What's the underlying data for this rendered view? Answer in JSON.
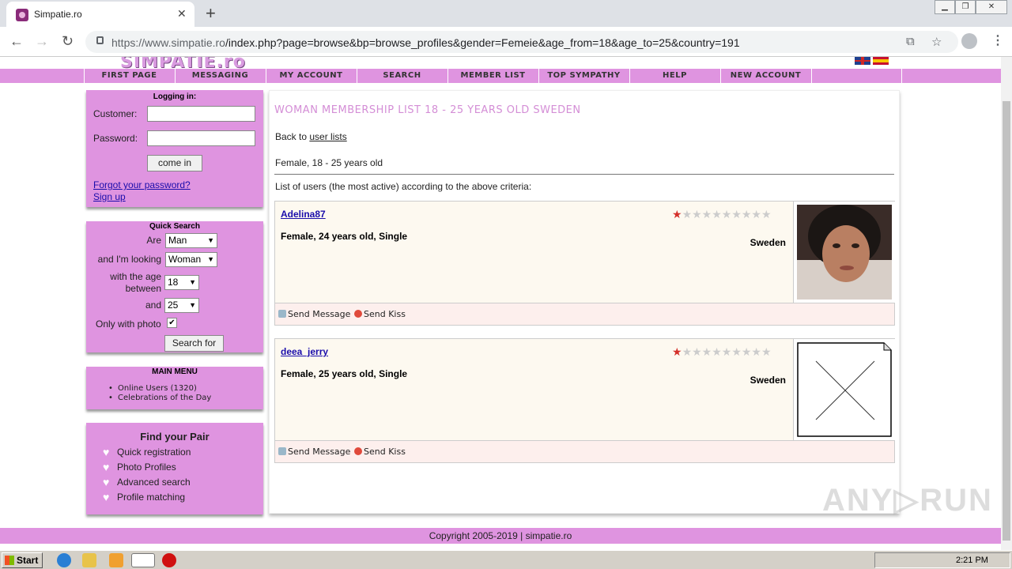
{
  "browser": {
    "tab_title": "Simpatie.ro",
    "tab_close": "✕",
    "new_tab": "+",
    "url_domain": "https://www.simpatie.ro",
    "url_path": "/index.php?page=browse&bp=browse_profiles&gender=Femeie&age_from=18&age_to=25&country=191",
    "back": "←",
    "forward": "→",
    "reload": "↻",
    "translate_icon": "⧉",
    "bookmark_icon": "☆",
    "menu": "⋮",
    "window_controls": [
      "▁",
      "❐",
      "✕"
    ]
  },
  "site": {
    "logo": "SIMPATIE.ro",
    "nav": [
      "FIRST PAGE",
      "MESSAGING",
      "MY ACCOUNT",
      "SEARCH",
      "MEMBER LIST",
      "TOP SYMPATHY",
      "HELP",
      "NEW ACCOUNT"
    ]
  },
  "login": {
    "title": "Logging in:",
    "customer_label": "Customer:",
    "password_label": "Password:",
    "submit": "come in",
    "forgot": "Forgot your password?",
    "signup": "Sign up"
  },
  "quick_search": {
    "title": "Quick Search",
    "are_label": "Are",
    "are_value": "Man",
    "looking_label": "and I'm looking",
    "looking_value": "Woman",
    "age_label_1": "with the age",
    "age_label_2": "between",
    "age_from": "18",
    "and_label": "and",
    "age_to": "25",
    "photo_label": "Only with photo",
    "photo_checked": "✔",
    "submit": "Search for"
  },
  "main_menu": {
    "title": "MAIN MENU",
    "items": [
      "Online Users (1320)",
      "Celebrations of the Day"
    ]
  },
  "find_pair": {
    "title": "Find your Pair",
    "items": [
      "Quick registration",
      "Photo Profiles",
      "Advanced search",
      "Profile matching"
    ]
  },
  "content": {
    "heading": "WOMAN MEMBERSHIP LIST 18 - 25 YEARS OLD SWEDEN",
    "back_prefix": "Back to",
    "back_link": "user lists",
    "criteria": "Female, 18 - 25 years old",
    "list_intro": "List of users (the most active) according to the above criteria:",
    "profiles": [
      {
        "username": "Adelina87",
        "info": "Female, 24 years old, Single",
        "country": "Sweden",
        "rating": 1,
        "photo": "portrait"
      },
      {
        "username": "deea_jerry",
        "info": "Female, 25 years old, Single",
        "country": "Sweden",
        "rating": 1,
        "photo": "missing"
      }
    ],
    "send_message": "Send Message",
    "send_kiss": "Send Kiss"
  },
  "footer": "Copyright 2005-2019 | simpatie.ro",
  "watermark": "ANY▷RUN",
  "taskbar": {
    "start": "Start",
    "clock": "2:21 PM"
  },
  "colors": {
    "site_pink": "#df94e0",
    "heading_pink": "#d48ed6",
    "link_blue": "#1a0dab",
    "star_red": "#d4302a"
  }
}
